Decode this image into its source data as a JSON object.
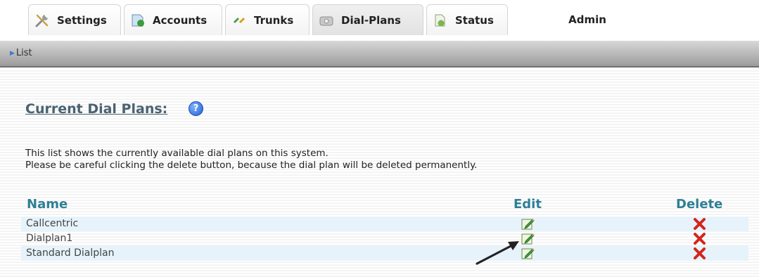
{
  "tabs": [
    {
      "label": "Settings",
      "icon": "tools-icon"
    },
    {
      "label": "Accounts",
      "icon": "accounts-icon"
    },
    {
      "label": "Trunks",
      "icon": "trunks-icon"
    },
    {
      "label": "Dial-Plans",
      "icon": "phone-icon"
    },
    {
      "label": "Status",
      "icon": "status-icon"
    }
  ],
  "admin_label": "Admin",
  "nav": {
    "link": "List"
  },
  "page": {
    "title": "Current Dial Plans:",
    "help": "?",
    "desc_line1": "This list shows the currently available dial plans on this system.",
    "desc_line2": "Please be careful clicking the delete button, because the dial plan will be deleted permanently."
  },
  "table": {
    "headers": {
      "name": "Name",
      "edit": "Edit",
      "delete": "Delete"
    },
    "rows": [
      {
        "name": "Callcentric"
      },
      {
        "name": "Dialplan1"
      },
      {
        "name": "Standard Dialplan"
      }
    ]
  },
  "colors": {
    "header_teal": "#2e7f95",
    "title": "#4a6273",
    "delete_red": "#d3261b",
    "row_alt": "#e6f3fb"
  }
}
